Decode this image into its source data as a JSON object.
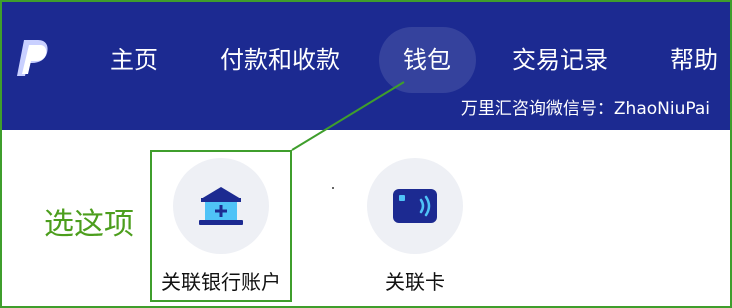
{
  "navbar": {
    "bg_color": "#1c2a91",
    "logo_icon": "paypal-logo-icon",
    "items": [
      {
        "label": "主页"
      },
      {
        "label": "付款和收款"
      },
      {
        "label": "钱包",
        "active": true
      },
      {
        "label": "交易记录"
      },
      {
        "label": "帮助"
      }
    ],
    "watermark": "万里汇咨询微信号：ZhaoNiuPai"
  },
  "annotation": {
    "hint_text": "选这项",
    "color": "#3f9e2c"
  },
  "options": [
    {
      "label": "关联银行账户",
      "icon": "bank-icon"
    },
    {
      "label": "关联卡",
      "icon": "contactless-card-icon"
    }
  ]
}
